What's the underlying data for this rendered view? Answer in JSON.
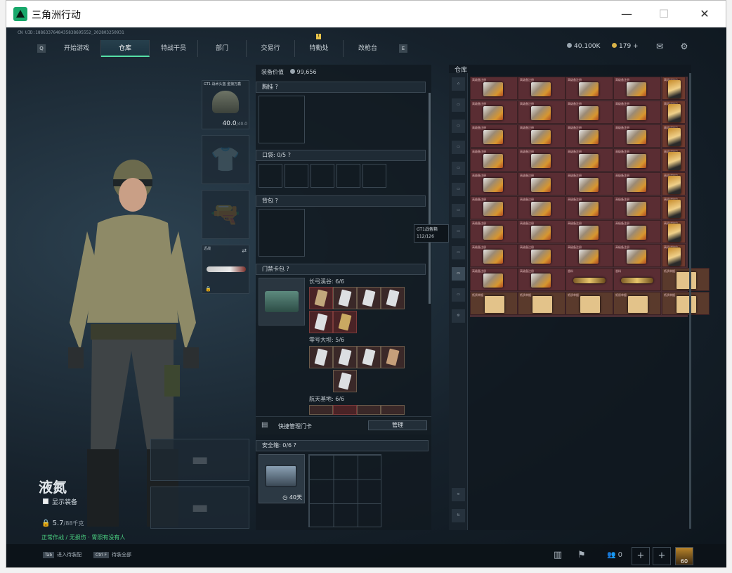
{
  "window": {
    "title": "三角洲行动",
    "minimize": "—",
    "maximize": "☐",
    "close": "✕"
  },
  "uid": "CN UID:1886337648435838695552_202803250931",
  "nav": {
    "left_key": "Q",
    "right_key": "E",
    "tabs": [
      "开始游戏",
      "仓库",
      "特战干员",
      "部门",
      "交易行",
      "特勤处",
      "改枪台"
    ],
    "active": "仓库",
    "badge": "!"
  },
  "currency": {
    "silver": "40.100K",
    "gold": "179 +"
  },
  "icons": {
    "mail": "mail-icon",
    "settings": "gear-icon"
  },
  "left_slots": {
    "helmet": {
      "label": "GT1 战术头盔 金狼万鑫",
      "value": "40.0",
      "max": "/40.0"
    },
    "melee": {
      "label": "近战"
    }
  },
  "character": {
    "name": "液氮",
    "show_gear": "显示装备",
    "weight": "5.7",
    "weight_max": "/88千克",
    "status": "正常作战 / 无损伤 · 胃照有没有人"
  },
  "middle": {
    "equip_value_label": "装备价值",
    "equip_value": "99,656",
    "chest": "胸挂 ?",
    "pocket": "口袋:",
    "pocket_count": "0/5",
    "backpack": "背包 ?",
    "keycard": "门禁卡包 ?",
    "groups": [
      {
        "name": "长弓溪谷:",
        "count": "6/6"
      },
      {
        "name": "零号大坝:",
        "count": "5/6"
      },
      {
        "name": "航天基地:",
        "count": "6/6"
      }
    ],
    "quick_manage": "快捷管理门卡",
    "manage_button": "管理",
    "safe": "安全箱:",
    "safe_count": "0/6",
    "safe_timer": "40天"
  },
  "tooltip": {
    "line1": "GT1战备箱",
    "line2": "112/126"
  },
  "warehouse": {
    "title": "仓库",
    "item_label": "高级备注册",
    "bag_label": "高级储物包",
    "dagger_label": "香料",
    "paper_label": "纸质单据"
  },
  "bottom": {
    "tab_key": "Tab",
    "tab_label": "进入待装配",
    "ctrl_key": "Ctrl F",
    "ctrl_label": "待装全部",
    "friends_count": "0",
    "level": "60"
  },
  "colors": {
    "accent": "#56e0a6",
    "cell": "#5a2d33",
    "panel": "#121b22"
  }
}
